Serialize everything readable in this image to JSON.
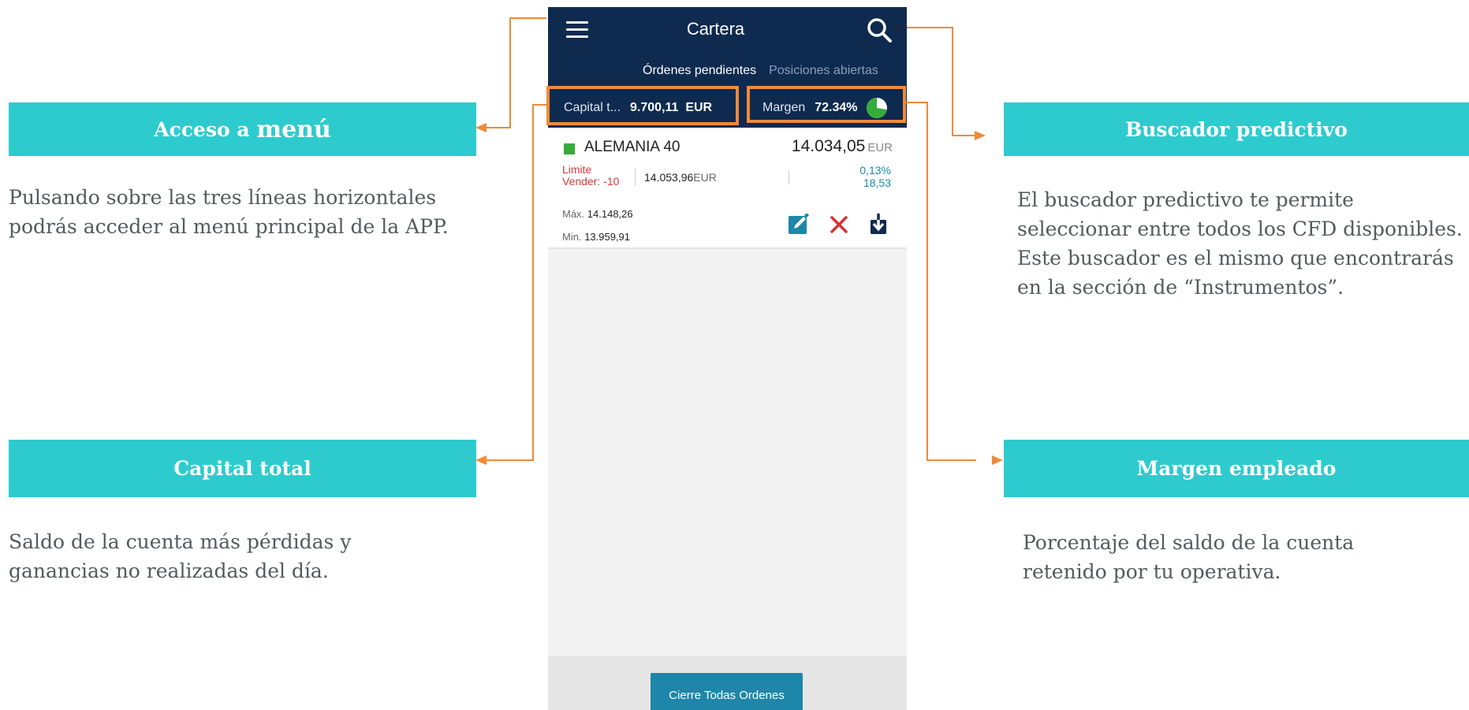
{
  "app": {
    "title": "Cartera",
    "tabs": [
      {
        "label": "Órdenes pendientes",
        "active": true
      },
      {
        "label": "Posiciones abiertas",
        "active": false
      }
    ],
    "capital": {
      "label": "Capital t...",
      "value": "9.700,11  EUR"
    },
    "margin": {
      "label": "Margen",
      "value": "72.34%"
    },
    "order": {
      "instrument": "ALEMANIA 40",
      "price": "14.034,05",
      "price_currency": "EUR",
      "limit_label": "Limite",
      "limit_action": "Vender: -10",
      "limit_price": "14.053,96",
      "limit_currency": "EUR",
      "change_pct": "0,13%",
      "change_abs": "18,53",
      "max_label": "Máx.",
      "max_value": "14.148,26",
      "min_label": "Min.",
      "min_value": "13.959,91"
    },
    "close_all_label": "Cierre Todas Ordenes"
  },
  "callouts": {
    "menu": {
      "title_prefix": "Acceso a",
      "title_emphasis": "menú",
      "description": "Pulsando sobre las tres líneas horizontales podrás acceder al menú principal de la APP."
    },
    "capital": {
      "title": "Capital total",
      "description": "Saldo de la cuenta más pérdidas y ganancias no realizadas del día."
    },
    "search": {
      "title": "Buscador predictivo",
      "description": "El buscador predictivo te permite seleccionar entre todos los CFD disponibles. Este buscador es el mismo que encontrarás en la sección de “Instrumentos”."
    },
    "margin": {
      "title": "Margen empleado",
      "description": "Porcentaje del saldo de la cuenta retenido por tu operativa."
    }
  },
  "colors": {
    "callout_bg": "#2ecbce",
    "phone_header": "#0e2a4f",
    "highlight": "#ef8a3a",
    "button": "#1e86a8"
  },
  "margin_level": 0.7234
}
